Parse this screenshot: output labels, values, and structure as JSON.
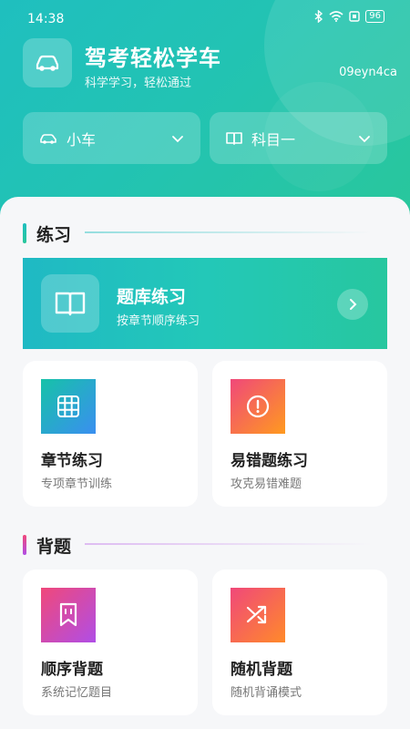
{
  "status_bar": {
    "time": "14:38",
    "battery": "96"
  },
  "app": {
    "title": "驾考轻松学车",
    "subtitle": "科学学习，轻松通过",
    "user_id": "09eyn4ca"
  },
  "selectors": {
    "car_type": {
      "label": "小车",
      "icon": "car-icon"
    },
    "subject": {
      "label": "科目一",
      "icon": "book-icon"
    }
  },
  "sections": {
    "practice": {
      "title": "练习",
      "accent": "#1bb8b0"
    },
    "memorize": {
      "title": "背题",
      "accent": "#d94c9a"
    }
  },
  "banner": {
    "title": "题库练习",
    "subtitle": "按章节顺序练习"
  },
  "cards": {
    "chapter": {
      "title": "章节练习",
      "subtitle": "专项章节训练",
      "icon": "grid-icon"
    },
    "mistakes": {
      "title": "易错题练习",
      "subtitle": "攻克易错难题",
      "icon": "alert-icon"
    },
    "sequential": {
      "title": "顺序背题",
      "subtitle": "系统记忆题目",
      "icon": "bookmark-icon"
    },
    "random": {
      "title": "随机背题",
      "subtitle": "随机背诵模式",
      "icon": "shuffle-icon"
    }
  },
  "colors": {
    "header_start": "#1fbfbf",
    "header_end": "#29c79c",
    "chapter_icon": [
      "#16c2a8",
      "#3a8ff0"
    ],
    "mistakes_icon": [
      "#f0487a",
      "#ff9a1f"
    ],
    "sequential_icon": [
      "#f0487a",
      "#b04ee6"
    ],
    "random_icon": [
      "#f0487a",
      "#ff8a2a"
    ]
  }
}
